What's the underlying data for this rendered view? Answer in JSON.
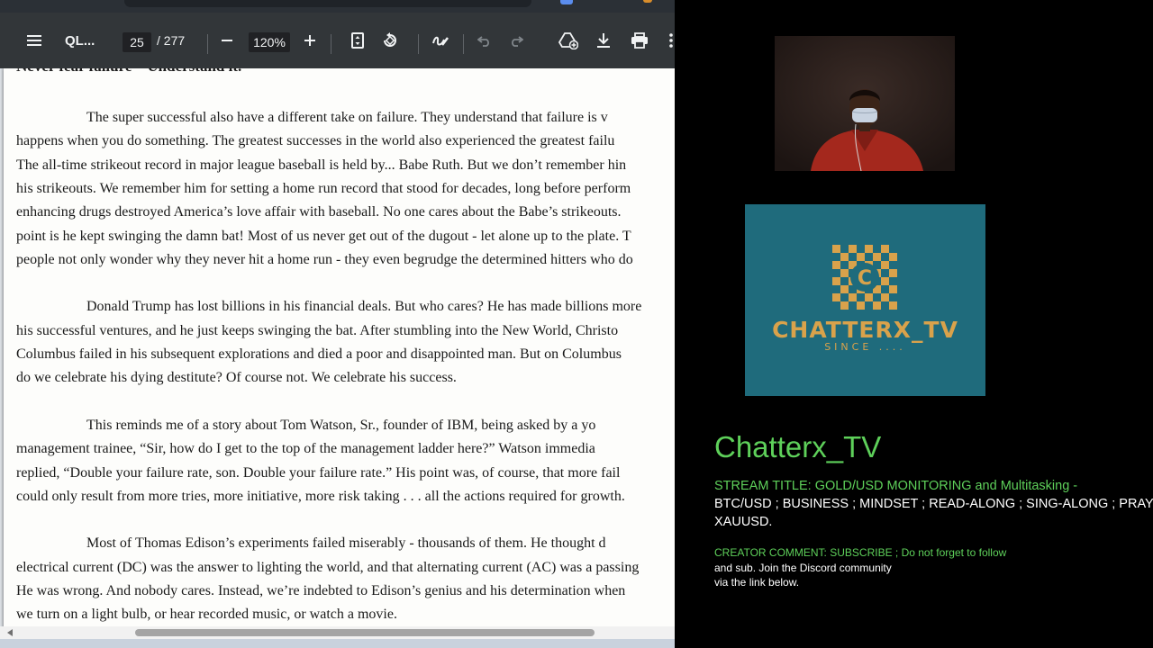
{
  "viewer": {
    "doc_title": "QL...",
    "page_current": "25",
    "page_total": "/ 277",
    "zoom": "120%",
    "page_lines": [
      {
        "text": "The super successful also have a different take on failure.   They understand that failure is v",
        "indent": true
      },
      {
        "text": "happens when you do something.  The greatest successes in the world also experienced the greatest failu"
      },
      {
        "text": "The all-time strikeout record in major league baseball is held by... Babe Ruth.  But we don’t remember hin"
      },
      {
        "text": "his strikeouts.  We remember him for setting a home run record that stood for decades, long before perform"
      },
      {
        "text": "enhancing drugs destroyed America’s love affair with baseball.  No one cares about the Babe’s strikeouts."
      },
      {
        "text": "point is he kept swinging the damn bat!  Most of us never get out of the dugout - let alone up to the plate.  T"
      },
      {
        "text": "people not only wonder why they never hit a home run - they even begrudge the determined hitters who do"
      },
      {
        "text": "Donald Trump has lost billions in his financial deals.  But who cares?  He has made billions more",
        "indent": true,
        "gap": true
      },
      {
        "text": "his successful ventures, and he just keeps swinging the bat.  After stumbling into the New World, Christo"
      },
      {
        "text": "Columbus failed in his subsequent explorations and died a poor and disappointed man.  But on Columbus"
      },
      {
        "text": "do we celebrate his dying destitute?  Of course not.  We celebrate his success."
      },
      {
        "text": "This reminds me of a story about Tom Watson, Sr., founder of IBM, being asked by a yo",
        "indent": true,
        "gap": true
      },
      {
        "text": "management trainee, “Sir, how do I get to the top of the management ladder here?”   Watson immedia"
      },
      {
        "text": "replied, “Double your failure rate, son.  Double your failure rate.”  His point was, of course, that more fail"
      },
      {
        "text": "could only result from more tries, more initiative, more risk taking . . . all the actions required for growth."
      },
      {
        "text": "Most of Thomas Edison’s experiments failed miserably - thousands of them.  He thought d",
        "indent": true,
        "gap": true
      },
      {
        "text": "electrical current (DC) was the answer to lighting the world, and that alternating current (AC) was a passing"
      },
      {
        "text": "He was wrong.  And nobody cares.  Instead, we’re indebted to Edison’s genius and his determination when"
      },
      {
        "text": "we turn on a light bulb, or hear recorded music, or watch a movie."
      }
    ],
    "heading_cut": "Never fear failure – Understand it."
  },
  "overlay": {
    "logo_name": "CHATTERX_TV",
    "logo_letter": "C",
    "logo_since": "SINCE ....",
    "channel_name": "Chatterx_TV",
    "stream_title_label": "STREAM TITLE: GOLD/USD MONITORING and Multitasking -",
    "stream_title_line2": "BTC/USD ; BUSINESS ; MINDSET ; READ-ALONG ; SING-ALONG ; PRAY",
    "stream_title_line3": "XAUUSD.",
    "creator_comment_label": "CREATOR COMMENT: SUBSCRIBE ; Do not forget to follow",
    "creator_comment_line2": "and sub. Join the Discord community",
    "creator_comment_line3": "via the link below."
  },
  "colors": {
    "accent_green": "#5ed05a",
    "logo_teal": "#1f6b7c",
    "logo_gold": "#d9a24b",
    "toolbar_bg": "#323639"
  },
  "icons": [
    "menu-icon",
    "fit-page-icon",
    "rotate-icon",
    "draw-icon",
    "undo-icon",
    "redo-icon",
    "add-to-drive-icon",
    "download-icon",
    "print-icon",
    "more-icon",
    "zoom-out-icon",
    "zoom-in-icon"
  ]
}
